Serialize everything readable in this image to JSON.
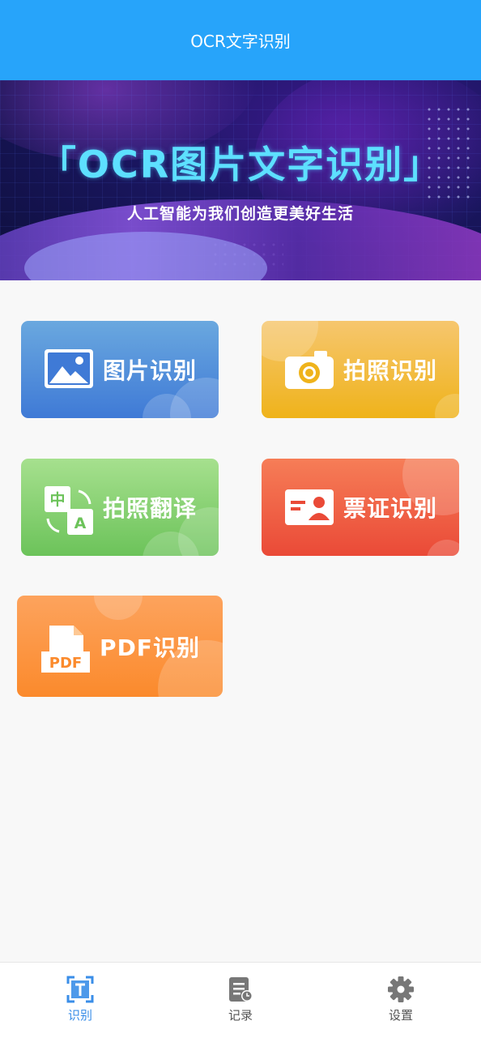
{
  "app_bar": {
    "title": "OCR文字识别"
  },
  "banner": {
    "title": "「OCR图片文字识别」",
    "subtitle": "人工智能为我们创造更美好生活"
  },
  "features": {
    "image": {
      "label": "图片识别",
      "icon": "image-icon"
    },
    "camera": {
      "label": "拍照识别",
      "icon": "camera-icon"
    },
    "translate": {
      "label": "拍照翻译",
      "icon": "translate-icon",
      "icon_text_cn": "中",
      "icon_text_en": "A"
    },
    "certificate": {
      "label": "票证识别",
      "icon": "id-card-icon"
    },
    "pdf": {
      "label": "PDF识别",
      "icon": "pdf-icon",
      "icon_text": "PDF"
    }
  },
  "tabbar": {
    "active": "recognize",
    "items": [
      {
        "label": "识别",
        "icon": "text-scan-icon",
        "color": "#3a8ee8"
      },
      {
        "label": "记录",
        "icon": "history-document-icon",
        "color": "#777777"
      },
      {
        "label": "设置",
        "icon": "gear-icon",
        "color": "#777777"
      }
    ]
  },
  "colors": {
    "app_bar": "#27a4fa",
    "accent": "#3a8ee8",
    "background": "#f8f8f8"
  }
}
